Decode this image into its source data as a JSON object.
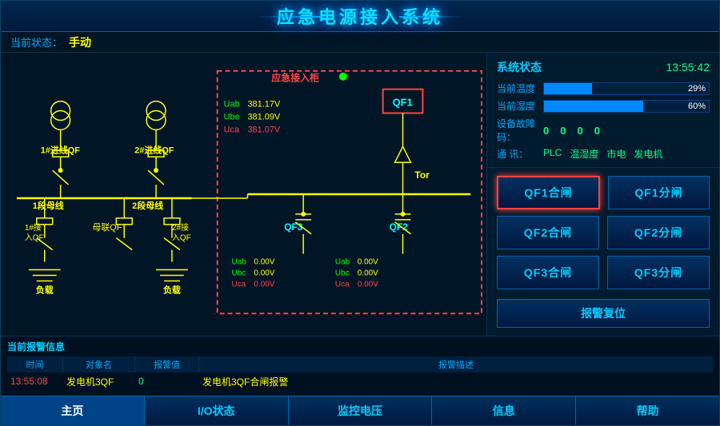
{
  "header": {
    "title": "应急电源接入系统"
  },
  "status_bar": {
    "label": "当前状态：",
    "value": "手动"
  },
  "system_status": {
    "title": "系统状态",
    "time": "13:55:42",
    "temp_label": "当前温度",
    "temp_value": "29%",
    "temp_percent": 29,
    "humidity_label": "当前湿度",
    "humidity_value": "60%",
    "humidity_percent": 60,
    "fault_label": "设备故障码：",
    "fault_values": [
      "0",
      "0",
      "0",
      "0"
    ],
    "comm_label": "通  讯：",
    "comm_items": [
      "PLC",
      "温湿度",
      "市电",
      "发电机"
    ]
  },
  "buttons": {
    "qf1_close": "QF1合闸",
    "qf1_open": "QF1分闸",
    "qf2_close": "QF2合闸",
    "qf2_open": "QF2分闸",
    "qf3_close": "QF3合闸",
    "qf3_open": "QF3分闸",
    "alert_reset": "报警复位"
  },
  "diagram": {
    "emergency_label": "应急接入柜",
    "feeder1_label": "1#进线QF",
    "feeder2_label": "2#进线QF",
    "bus1_label": "1段母线",
    "bus2_label": "2段母线",
    "tie_label": "母联QF",
    "input1_label": "1#接入QF",
    "input2_label": "2#接入QF",
    "load1_label": "负载",
    "load2_label": "负载",
    "qf1_label": "QF1",
    "qf3_label": "QF3",
    "qf2_label": "QF2",
    "vab1": "381.17V",
    "vbc1": "381.09V",
    "vca1": "381.07V",
    "vab2": "0.00V",
    "vbc2": "0.00V",
    "vca2": "0.00V",
    "vab3": "0.00V",
    "vbc3": "0.00V",
    "vca3": "0.00V",
    "vab_label1": "Uab",
    "vbc_label1": "Ube",
    "vca_label1": "Uca",
    "vab_label2": "Uab",
    "vbc_label2": "Ubc",
    "vca_label2": "Uca",
    "tor_label": "Tor"
  },
  "alert": {
    "title": "当前报警信息",
    "col_time": "时间",
    "col_name": "对象名",
    "col_val": "报警值",
    "col_desc": "报警描述",
    "rows": [
      {
        "time": "13:55:08",
        "name": "发电机3QF",
        "val": "0",
        "desc": "发电机3QF合闸报警"
      }
    ]
  },
  "nav": {
    "items": [
      "主页",
      "I/O状态",
      "监控电压",
      "信息",
      "帮助"
    ]
  }
}
